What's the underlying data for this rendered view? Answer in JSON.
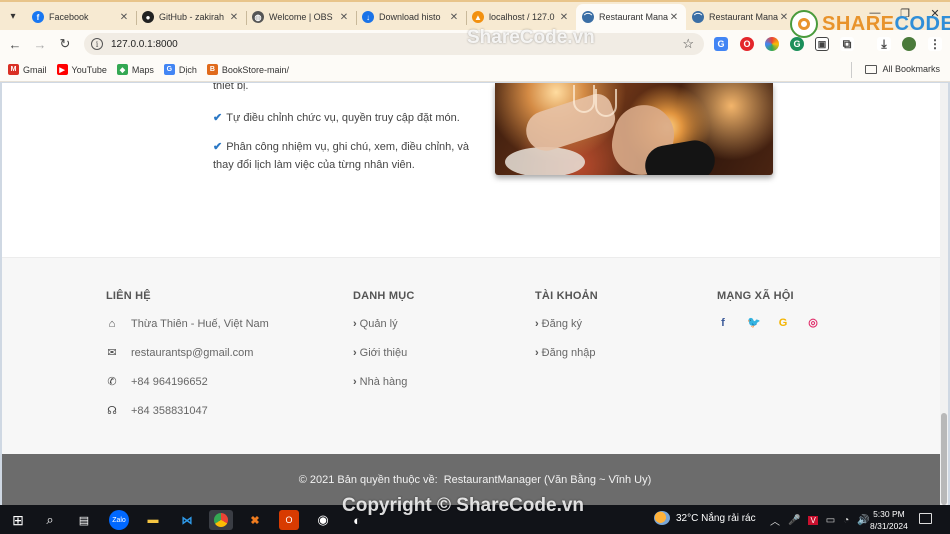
{
  "browser": {
    "tabs": [
      {
        "title": "Facebook",
        "icon": "facebook-icon",
        "color": "#1877f2",
        "glyph": "f"
      },
      {
        "title": "GitHub - zakirah",
        "icon": "github-icon",
        "color": "#222222",
        "glyph": "●"
      },
      {
        "title": "Welcome | OBS",
        "icon": "globe-icon",
        "color": "#555555",
        "glyph": "◍"
      },
      {
        "title": "Download histo",
        "icon": "download-icon",
        "color": "#1a73e8",
        "glyph": "↓"
      },
      {
        "title": "localhost / 127.0",
        "icon": "phpmyadmin-icon",
        "color": "#f29111",
        "glyph": "▲"
      },
      {
        "title": "Restaurant Mana",
        "icon": "restaurant-icon",
        "color": "#3a6ea5",
        "glyph": "⌒"
      },
      {
        "title": "Restaurant Mana",
        "icon": "restaurant-icon",
        "color": "#3a6ea5",
        "glyph": "⌒"
      }
    ],
    "active_tab_index": 5,
    "url": "127.0.0.1:8000",
    "bookmarks": [
      {
        "label": "Gmail",
        "icon": "gmail-icon",
        "color": "#d93025",
        "glyph": "M"
      },
      {
        "label": "YouTube",
        "icon": "youtube-icon",
        "color": "#ff0000",
        "glyph": "▶"
      },
      {
        "label": "Maps",
        "icon": "maps-icon",
        "color": "#34a853",
        "glyph": "◆"
      },
      {
        "label": "Dịch",
        "icon": "translate-icon",
        "color": "#4285f4",
        "glyph": "G"
      },
      {
        "label": "BookStore-main/",
        "icon": "bookstore-icon",
        "color": "#e06a1b",
        "glyph": "B"
      }
    ],
    "all_bookmarks": "All Bookmarks"
  },
  "page": {
    "feature_top": "thiết bị.",
    "features": [
      "Tự điều chỉnh chức vụ, quyền truy cập đặt món.",
      "Phân công nhiệm vụ, ghi chú, xem, điều chỉnh, và thay đổi lịch làm việc của từng nhân viên."
    ],
    "footer": {
      "contact": {
        "heading": "LIÊN HỆ",
        "items": [
          {
            "icon": "home-icon",
            "glyph": "⌂",
            "text": "Thừa Thiên - Huế, Việt Nam"
          },
          {
            "icon": "envelope-icon",
            "glyph": "✉",
            "text": "restaurantsp@gmail.com"
          },
          {
            "icon": "phone-icon",
            "glyph": "✆",
            "text": "+84 964196652"
          },
          {
            "icon": "headset-icon",
            "glyph": "☊",
            "text": "+84 358831047"
          }
        ]
      },
      "categories": {
        "heading": "DANH MỤC",
        "items": [
          "Quản lý",
          "Giới thiệu",
          "Nhà hàng"
        ]
      },
      "account": {
        "heading": "TÀI KHOẢN",
        "items": [
          "Đăng ký",
          "Đăng nhập"
        ]
      },
      "social": {
        "heading": "MẠNG XÃ HỘI",
        "items": [
          {
            "icon": "facebook-icon",
            "glyph": "f",
            "color": "#3b5998"
          },
          {
            "icon": "twitter-icon",
            "glyph": "🐦",
            "color": "#1da1f2"
          },
          {
            "icon": "google-icon",
            "glyph": "G",
            "color": "#f4b400"
          },
          {
            "icon": "instagram-icon",
            "glyph": "◎",
            "color": "#e1306c"
          }
        ]
      },
      "copyright": "© 2021 Bản quyền thuộc về:",
      "brand": "RestaurantManager (Văn Bằng ~ Vĩnh Uy)"
    }
  },
  "taskbar": {
    "weather": "32°C  Nắng rải rác",
    "time": "5:30 PM",
    "date": "8/31/2024"
  },
  "watermarks": {
    "logo_text_a": "SHARE",
    "logo_text_b": "CODE.vn",
    "top": "ShareCode.vn",
    "bottom": "Copyright © ShareCode.vn"
  }
}
